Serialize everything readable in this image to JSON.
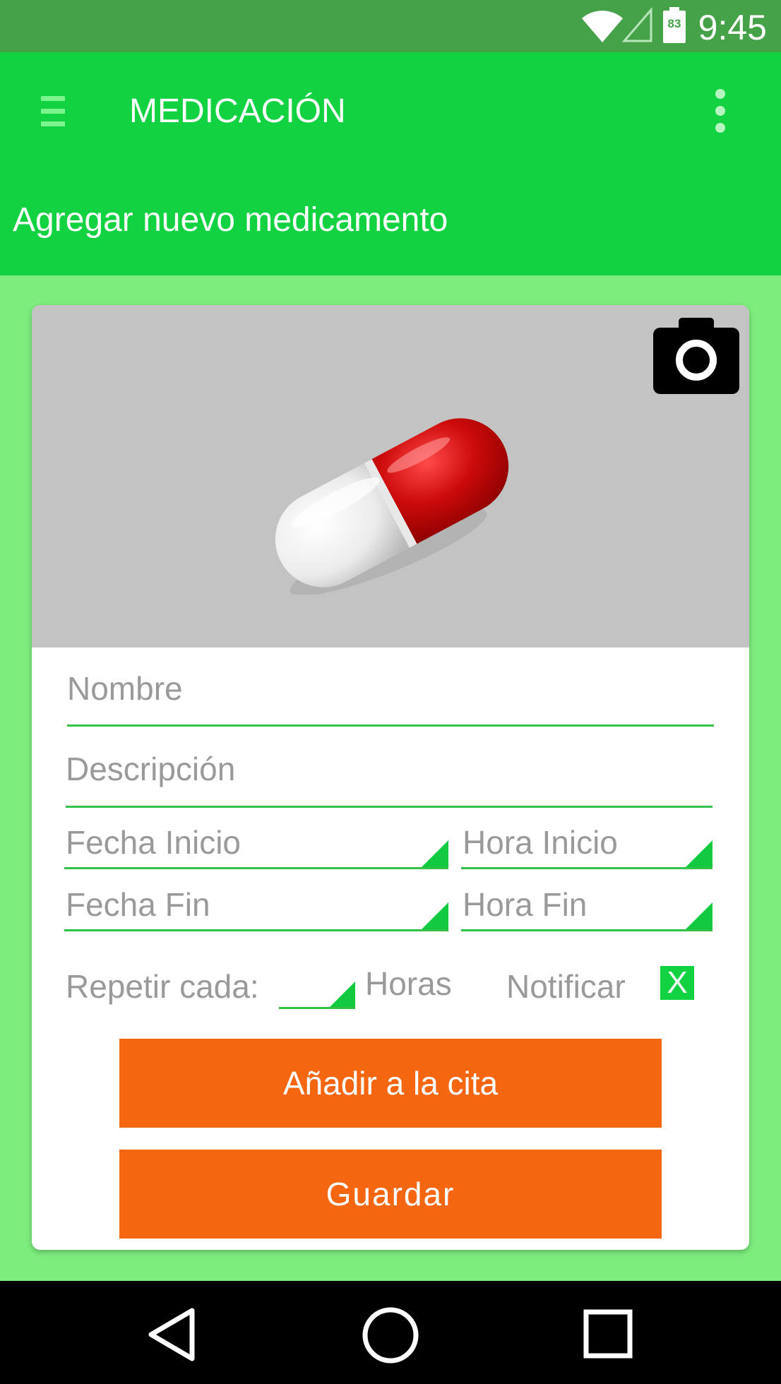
{
  "status_bar": {
    "time": "9:45",
    "battery_level": "83",
    "icons": [
      "wifi-icon",
      "signal-icon",
      "battery-icon"
    ]
  },
  "toolbar": {
    "title": "MEDICACIÓN",
    "menu_icon": "hamburger-menu-icon",
    "overflow_icon": "more-vert-icon"
  },
  "subheader": {
    "title": "Agregar nuevo medicamento"
  },
  "card": {
    "image": "capsule-pill-image",
    "camera_icon": "camera-icon",
    "fields": {
      "name": {
        "placeholder": "Nombre",
        "value": ""
      },
      "description": {
        "placeholder": "Descripción",
        "value": ""
      },
      "start_date": {
        "placeholder": "Fecha Inicio"
      },
      "start_time": {
        "placeholder": "Hora Inicio"
      },
      "end_date": {
        "placeholder": "Fecha Fin"
      },
      "end_time": {
        "placeholder": "Hora Fin"
      }
    },
    "repeat": {
      "label": "Repetir cada:",
      "unit": "Horas",
      "value": ""
    },
    "notify": {
      "label": "Notificar",
      "checkbox_mark": "X",
      "checked": true
    },
    "buttons": {
      "add_to_appointment": "Añadir a la cita",
      "save": "Guardar"
    }
  },
  "navbar": {
    "icons": [
      "back-icon",
      "home-icon",
      "recents-icon"
    ]
  },
  "colors": {
    "status_bar": "#45a249",
    "toolbar": "#12d242",
    "background": "#7ded7e",
    "accent": "#33c148",
    "button": "#f56611",
    "image_bg": "#c3c3c3"
  }
}
